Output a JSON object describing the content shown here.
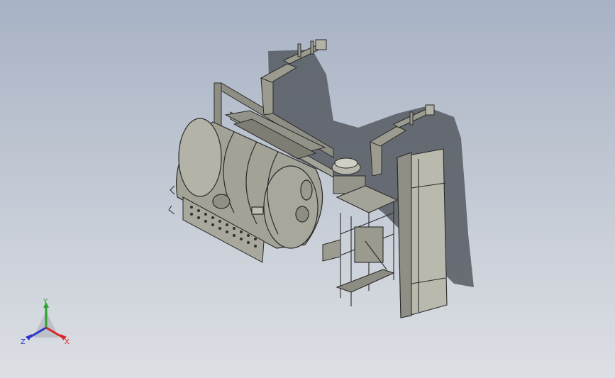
{
  "viewport": {
    "background_top": "#a7b2c4",
    "background_bottom": "#dcdfe4",
    "model_color": "#9a9a8c",
    "edge_color": "#2a2a2a",
    "shadow_color": "#565a62"
  },
  "triad": {
    "x_label": "X",
    "y_label": "Y",
    "z_label": "Z",
    "x_color": "#d8262a",
    "y_color": "#2fa12f",
    "z_color": "#2a36c8"
  }
}
